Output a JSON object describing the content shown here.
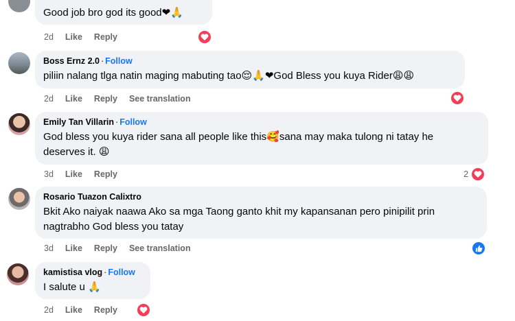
{
  "comments": [
    {
      "author": "",
      "follow": "",
      "text": "Good job bro god its good❤🙏",
      "time": "2d",
      "like": "Like",
      "reply": "Reply",
      "translate": "",
      "reaction": "love-icon",
      "reaction_count": ""
    },
    {
      "author": "Boss Ernz 2.0",
      "follow": "Follow",
      "text": "piliin nalang tlga natin maging mabuting tao😌🙏❤God Bless you kuya Rider😩😩",
      "time": "2d",
      "like": "Like",
      "reply": "Reply",
      "translate": "See translation",
      "reaction": "love-icon",
      "reaction_count": ""
    },
    {
      "author": "Emily Tan Villarin",
      "follow": "Follow",
      "text_line1": "God bless you kuya rider sana all people like this🥰sana may maka tulong ni tatay he",
      "text_line2": "deserves it. 😩",
      "time": "3d",
      "like": "Like",
      "reply": "Reply",
      "translate": "",
      "reaction": "love-icon",
      "reaction_count": "2"
    },
    {
      "author": "Rosario Tuazon Calixtro",
      "follow": "",
      "text_line1": "Bkit Ako naiyak naawa Ako sa mga Taong ganto khit my kapansanan pero pinipilit prin",
      "text_line2": "nagtrabho God bless you tatay",
      "time": "3d",
      "like": "Like",
      "reply": "Reply",
      "translate": "See translation",
      "reaction": "like-icon",
      "reaction_count": ""
    },
    {
      "author": "kamistisa vlog",
      "follow": "Follow",
      "text": "I salute u 🙏",
      "time": "2d",
      "like": "Like",
      "reply": "Reply",
      "translate": "",
      "reaction": "love-icon",
      "reaction_count": ""
    }
  ],
  "colors": {
    "bubble": "#f0f2f5",
    "follow": "#1877f2",
    "love": "#f33e58",
    "like": "#1877f2",
    "meta": "#65676b"
  }
}
